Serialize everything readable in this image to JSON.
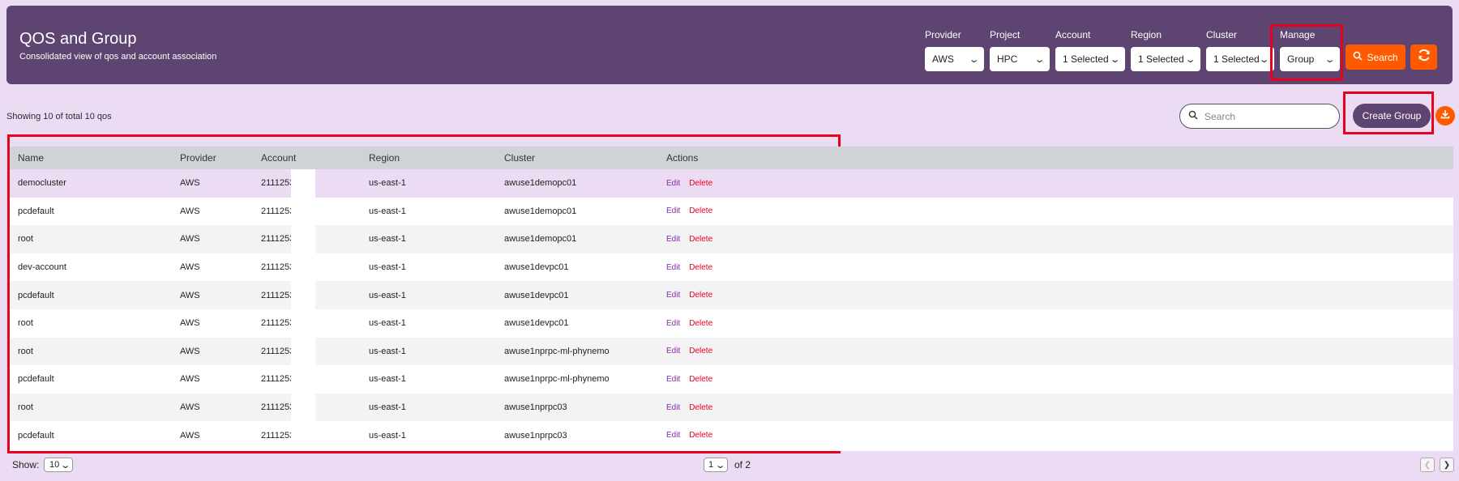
{
  "header": {
    "title": "QOS and Group",
    "subtitle": "Consolidated view of qos and account association"
  },
  "filters": [
    {
      "label": "Provider",
      "value": "AWS"
    },
    {
      "label": "Project",
      "value": "HPC"
    },
    {
      "label": "Account",
      "value": "1 Selected"
    },
    {
      "label": "Region",
      "value": "1 Selected"
    },
    {
      "label": "Cluster",
      "value": "1 Selected"
    },
    {
      "label": "Manage",
      "value": "Group"
    }
  ],
  "toolbar": {
    "search_label": "Search",
    "showing_text": "Showing 10 of total 10 qos",
    "search_placeholder": "Search",
    "create_label": "Create Group"
  },
  "table": {
    "columns": [
      "Name",
      "Provider",
      "Account",
      "Region",
      "Cluster",
      "Actions"
    ],
    "rows": [
      {
        "name": "democluster",
        "provider": "AWS",
        "account": "2111253",
        "region": "us-east-1",
        "cluster": "awuse1demopc01"
      },
      {
        "name": "pcdefault",
        "provider": "AWS",
        "account": "2111253",
        "region": "us-east-1",
        "cluster": "awuse1demopc01"
      },
      {
        "name": "root",
        "provider": "AWS",
        "account": "2111253",
        "region": "us-east-1",
        "cluster": "awuse1demopc01"
      },
      {
        "name": "dev-account",
        "provider": "AWS",
        "account": "2111253",
        "region": "us-east-1",
        "cluster": "awuse1devpc01"
      },
      {
        "name": "pcdefault",
        "provider": "AWS",
        "account": "2111253",
        "region": "us-east-1",
        "cluster": "awuse1devpc01"
      },
      {
        "name": "root",
        "provider": "AWS",
        "account": "2111253",
        "region": "us-east-1",
        "cluster": "awuse1devpc01"
      },
      {
        "name": "root",
        "provider": "AWS",
        "account": "2111253",
        "region": "us-east-1",
        "cluster": "awuse1nprpc-ml-phynemo"
      },
      {
        "name": "pcdefault",
        "provider": "AWS",
        "account": "2111253",
        "region": "us-east-1",
        "cluster": "awuse1nprpc-ml-phynemo"
      },
      {
        "name": "root",
        "provider": "AWS",
        "account": "2111253",
        "region": "us-east-1",
        "cluster": "awuse1nprpc03"
      },
      {
        "name": "pcdefault",
        "provider": "AWS",
        "account": "2111253",
        "region": "us-east-1",
        "cluster": "awuse1nprpc03"
      }
    ],
    "edit_label": "Edit",
    "delete_label": "Delete"
  },
  "pagination": {
    "show_label": "Show:",
    "page_size": "10",
    "current_page": "1",
    "of_label": "of 2"
  },
  "colors": {
    "header_bg": "#5e4470",
    "page_bg": "#ecdcf3",
    "accent_orange": "#ff5a00",
    "highlight_red": "#e8001c"
  }
}
